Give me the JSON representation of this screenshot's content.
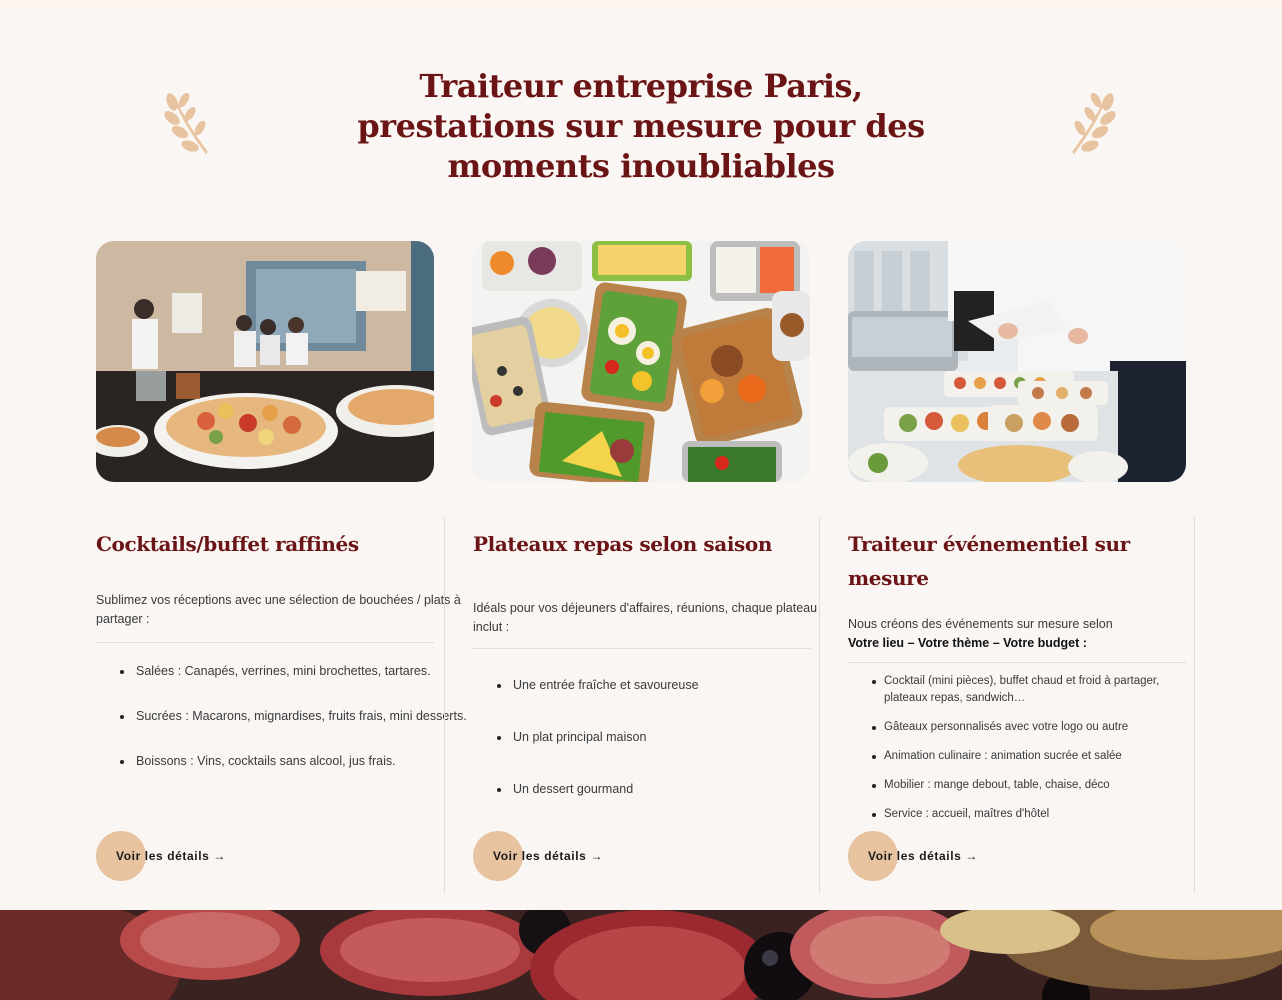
{
  "section": {
    "title": "Traiteur entreprise Paris, prestations sur mesure pour des moments inoubliables"
  },
  "cards": [
    {
      "image_alt": "Buffet cocktail en salle de réunion",
      "title": "Cocktails/buffet raffinés",
      "desc": "Sublimez vos réceptions avec une sélection de bouchées / plats à partager :",
      "items": [
        "Salées : Canapés, verrines, mini brochettes, tartares.",
        "Sucrées : Macarons, mignardises, fruits frais, mini desserts.",
        "Boissons : Vins, cocktails sans alcool, jus frais."
      ],
      "button": "Voir les détails →"
    },
    {
      "image_alt": "Plateaux repas vus de dessus",
      "title": "Plateaux repas selon saison",
      "desc": "Idéals pour vos déjeuners d'affaires, réunions, chaque plateau inclut :",
      "items": [
        "Une entrée fraîche et savoureuse",
        "Un plat principal maison",
        "Un dessert gourmand"
      ],
      "button": "Voir les détails →"
    },
    {
      "image_alt": "Serveurs dressant un buffet",
      "title": "Traiteur événementiel sur mesure",
      "desc": "Nous créons des événements sur mesure selon",
      "desc_bold": "Votre lieu – Votre thème – Votre budget :",
      "items": [
        "Cocktail (mini pièces), buffet chaud et froid à partager, plateaux repas, sandwich…",
        "Gâteaux personnalisés avec votre logo ou autre",
        "Animation culinaire : animation sucrée et salée",
        "Mobilier : mange debout, table, chaise, déco",
        "Service : accueil, maîtres d'hôtel"
      ],
      "button": "Voir les détails →"
    }
  ],
  "icons": {
    "laurel": "laurel-branch-icon"
  },
  "colors": {
    "accent": "#6b1416",
    "button": "#e8c3a0",
    "background": "#f9f6f4"
  }
}
